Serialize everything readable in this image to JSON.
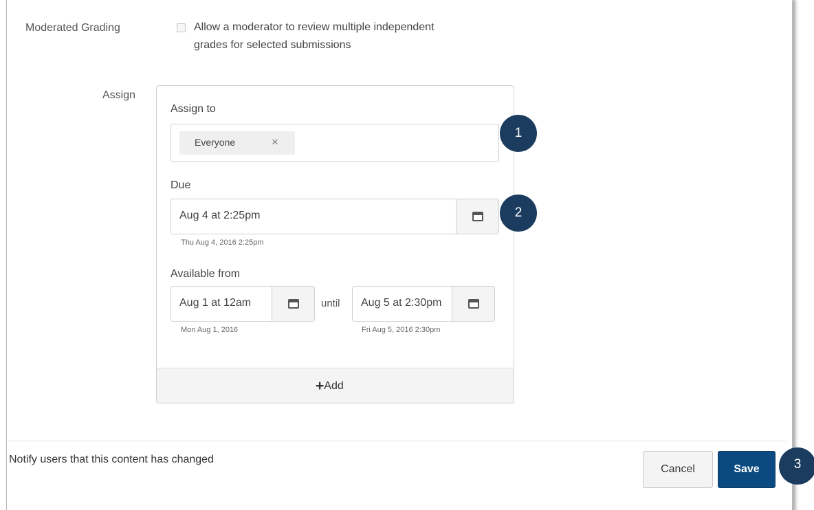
{
  "moderated": {
    "label": "Moderated Grading",
    "checkbox_line1": "Allow a moderator to review multiple independent",
    "checkbox_line2": "grades for selected submissions",
    "checked": false
  },
  "assign": {
    "label": "Assign",
    "assign_to_label": "Assign to",
    "token": "Everyone",
    "token_remove": "×",
    "due_label": "Due",
    "due_value": "Aug 4 at 2:25pm",
    "due_helper": "Thu Aug 4, 2016 2:25pm",
    "available_label": "Available from",
    "from_value": "Aug 1 at 12am",
    "from_helper": "Mon Aug 1, 2016",
    "until_label": "until",
    "until_value": "Aug 5 at 2:30pm",
    "until_helper": "Fri Aug 5, 2016 2:30pm",
    "add_plus": "+",
    "add_label": "Add"
  },
  "footer": {
    "notify": "Notify users that this content has changed",
    "cancel": "Cancel",
    "save": "Save"
  },
  "callouts": [
    "1",
    "2",
    "3"
  ],
  "colors": {
    "save_button": "#0b4a80",
    "callout": "#1b3c5e"
  },
  "icons": {
    "calendar": "calendar-icon",
    "remove": "close-icon",
    "add": "plus-icon"
  }
}
